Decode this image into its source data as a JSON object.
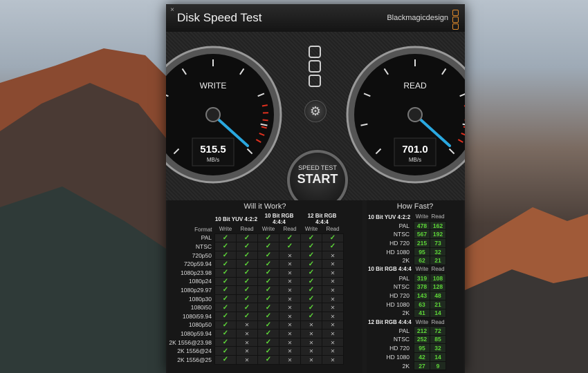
{
  "window": {
    "title": "Disk Speed Test",
    "brand": "Blackmagicdesign",
    "close": "×"
  },
  "gauges": {
    "write": {
      "label": "WRITE",
      "value": "515.5",
      "unit": "MB/s"
    },
    "read": {
      "label": "READ",
      "value": "701.0",
      "unit": "MB/s"
    }
  },
  "start_button": {
    "small": "SPEED TEST",
    "big": "START"
  },
  "gear_icon": "⚙",
  "will_it_work": {
    "title": "Will it Work?",
    "format_header": "Format",
    "groups": [
      "10 Bit YUV 4:2:2",
      "10 Bit RGB 4:4:4",
      "12 Bit RGB 4:4:4"
    ],
    "col_labels": [
      "Write",
      "Read"
    ],
    "rows": [
      {
        "format": "PAL",
        "v": [
          1,
          1,
          1,
          1,
          1,
          1
        ]
      },
      {
        "format": "NTSC",
        "v": [
          1,
          1,
          1,
          1,
          1,
          1
        ]
      },
      {
        "format": "720p50",
        "v": [
          1,
          1,
          1,
          0,
          1,
          0
        ]
      },
      {
        "format": "720p59.94",
        "v": [
          1,
          1,
          1,
          0,
          1,
          0
        ]
      },
      {
        "format": "1080p23.98",
        "v": [
          1,
          1,
          1,
          0,
          1,
          0
        ]
      },
      {
        "format": "1080p24",
        "v": [
          1,
          1,
          1,
          0,
          1,
          0
        ]
      },
      {
        "format": "1080p29.97",
        "v": [
          1,
          1,
          1,
          0,
          1,
          0
        ]
      },
      {
        "format": "1080p30",
        "v": [
          1,
          1,
          1,
          0,
          1,
          0
        ]
      },
      {
        "format": "1080i50",
        "v": [
          1,
          1,
          1,
          0,
          1,
          0
        ]
      },
      {
        "format": "1080i59.94",
        "v": [
          1,
          1,
          1,
          0,
          1,
          0
        ]
      },
      {
        "format": "1080p50",
        "v": [
          1,
          0,
          1,
          0,
          0,
          0
        ]
      },
      {
        "format": "1080p59.94",
        "v": [
          1,
          0,
          1,
          0,
          0,
          0
        ]
      },
      {
        "format": "2K 1556@23.98",
        "v": [
          1,
          0,
          1,
          0,
          0,
          0
        ]
      },
      {
        "format": "2K 1556@24",
        "v": [
          1,
          0,
          1,
          0,
          0,
          0
        ]
      },
      {
        "format": "2K 1556@25",
        "v": [
          1,
          0,
          1,
          0,
          0,
          0
        ]
      }
    ],
    "ok_glyph": "✓",
    "no_glyph": "✕"
  },
  "how_fast": {
    "title": "How Fast?",
    "col_labels": [
      "Write",
      "Read"
    ],
    "groups": [
      {
        "name": "10 Bit YUV 4:2:2",
        "rows": [
          {
            "label": "PAL",
            "write": "478",
            "read": "162"
          },
          {
            "label": "NTSC",
            "write": "567",
            "read": "192"
          },
          {
            "label": "HD 720",
            "write": "215",
            "read": "73"
          },
          {
            "label": "HD 1080",
            "write": "95",
            "read": "32"
          },
          {
            "label": "2K",
            "write": "62",
            "read": "21"
          }
        ]
      },
      {
        "name": "10 Bit RGB 4:4:4",
        "rows": [
          {
            "label": "PAL",
            "write": "319",
            "read": "108"
          },
          {
            "label": "NTSC",
            "write": "378",
            "read": "128"
          },
          {
            "label": "HD 720",
            "write": "143",
            "read": "48"
          },
          {
            "label": "HD 1080",
            "write": "63",
            "read": "21"
          },
          {
            "label": "2K",
            "write": "41",
            "read": "14"
          }
        ]
      },
      {
        "name": "12 Bit RGB 4:4:4",
        "rows": [
          {
            "label": "PAL",
            "write": "212",
            "read": "72"
          },
          {
            "label": "NTSC",
            "write": "252",
            "read": "85"
          },
          {
            "label": "HD 720",
            "write": "95",
            "read": "32"
          },
          {
            "label": "HD 1080",
            "write": "42",
            "read": "14"
          },
          {
            "label": "2K",
            "write": "27",
            "read": "9"
          }
        ]
      }
    ]
  },
  "colors": {
    "accent_green": "#5ed838",
    "needle_blue": "#2aa8e0",
    "redline": "#e0301e"
  }
}
